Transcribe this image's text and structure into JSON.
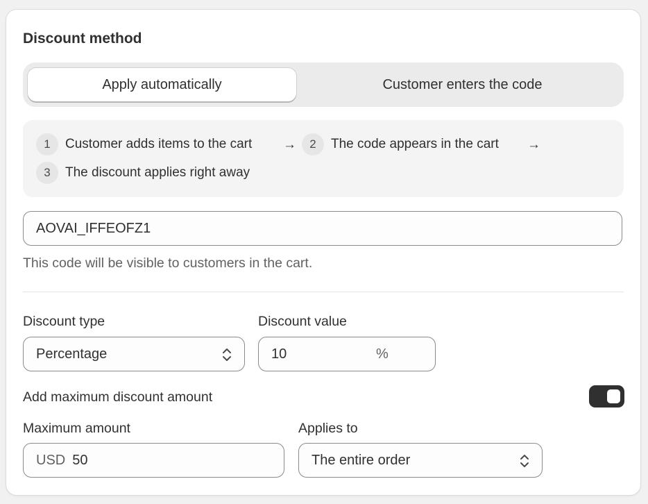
{
  "discount_method": {
    "title": "Discount method",
    "options": [
      "Apply automatically",
      "Customer enters the code"
    ],
    "selected_index": 0
  },
  "steps": [
    {
      "number": "1",
      "text": "Customer adds items to the cart"
    },
    {
      "number": "2",
      "text": "The code appears in the cart"
    },
    {
      "number": "3",
      "text": "The discount applies right away"
    }
  ],
  "arrow_glyph": "→",
  "code": {
    "value": "AOVAI_IFFEOFZ1",
    "help_text": "This code will be visible to customers in the cart."
  },
  "discount_type": {
    "label": "Discount type",
    "selected": "Percentage"
  },
  "discount_value": {
    "label": "Discount value",
    "value": "10",
    "suffix": "%"
  },
  "max_discount": {
    "label": "Add maximum discount amount",
    "enabled": true
  },
  "maximum_amount": {
    "label": "Maximum amount",
    "currency": "USD",
    "value": "50"
  },
  "applies_to": {
    "label": "Applies to",
    "selected": "The entire order"
  }
}
